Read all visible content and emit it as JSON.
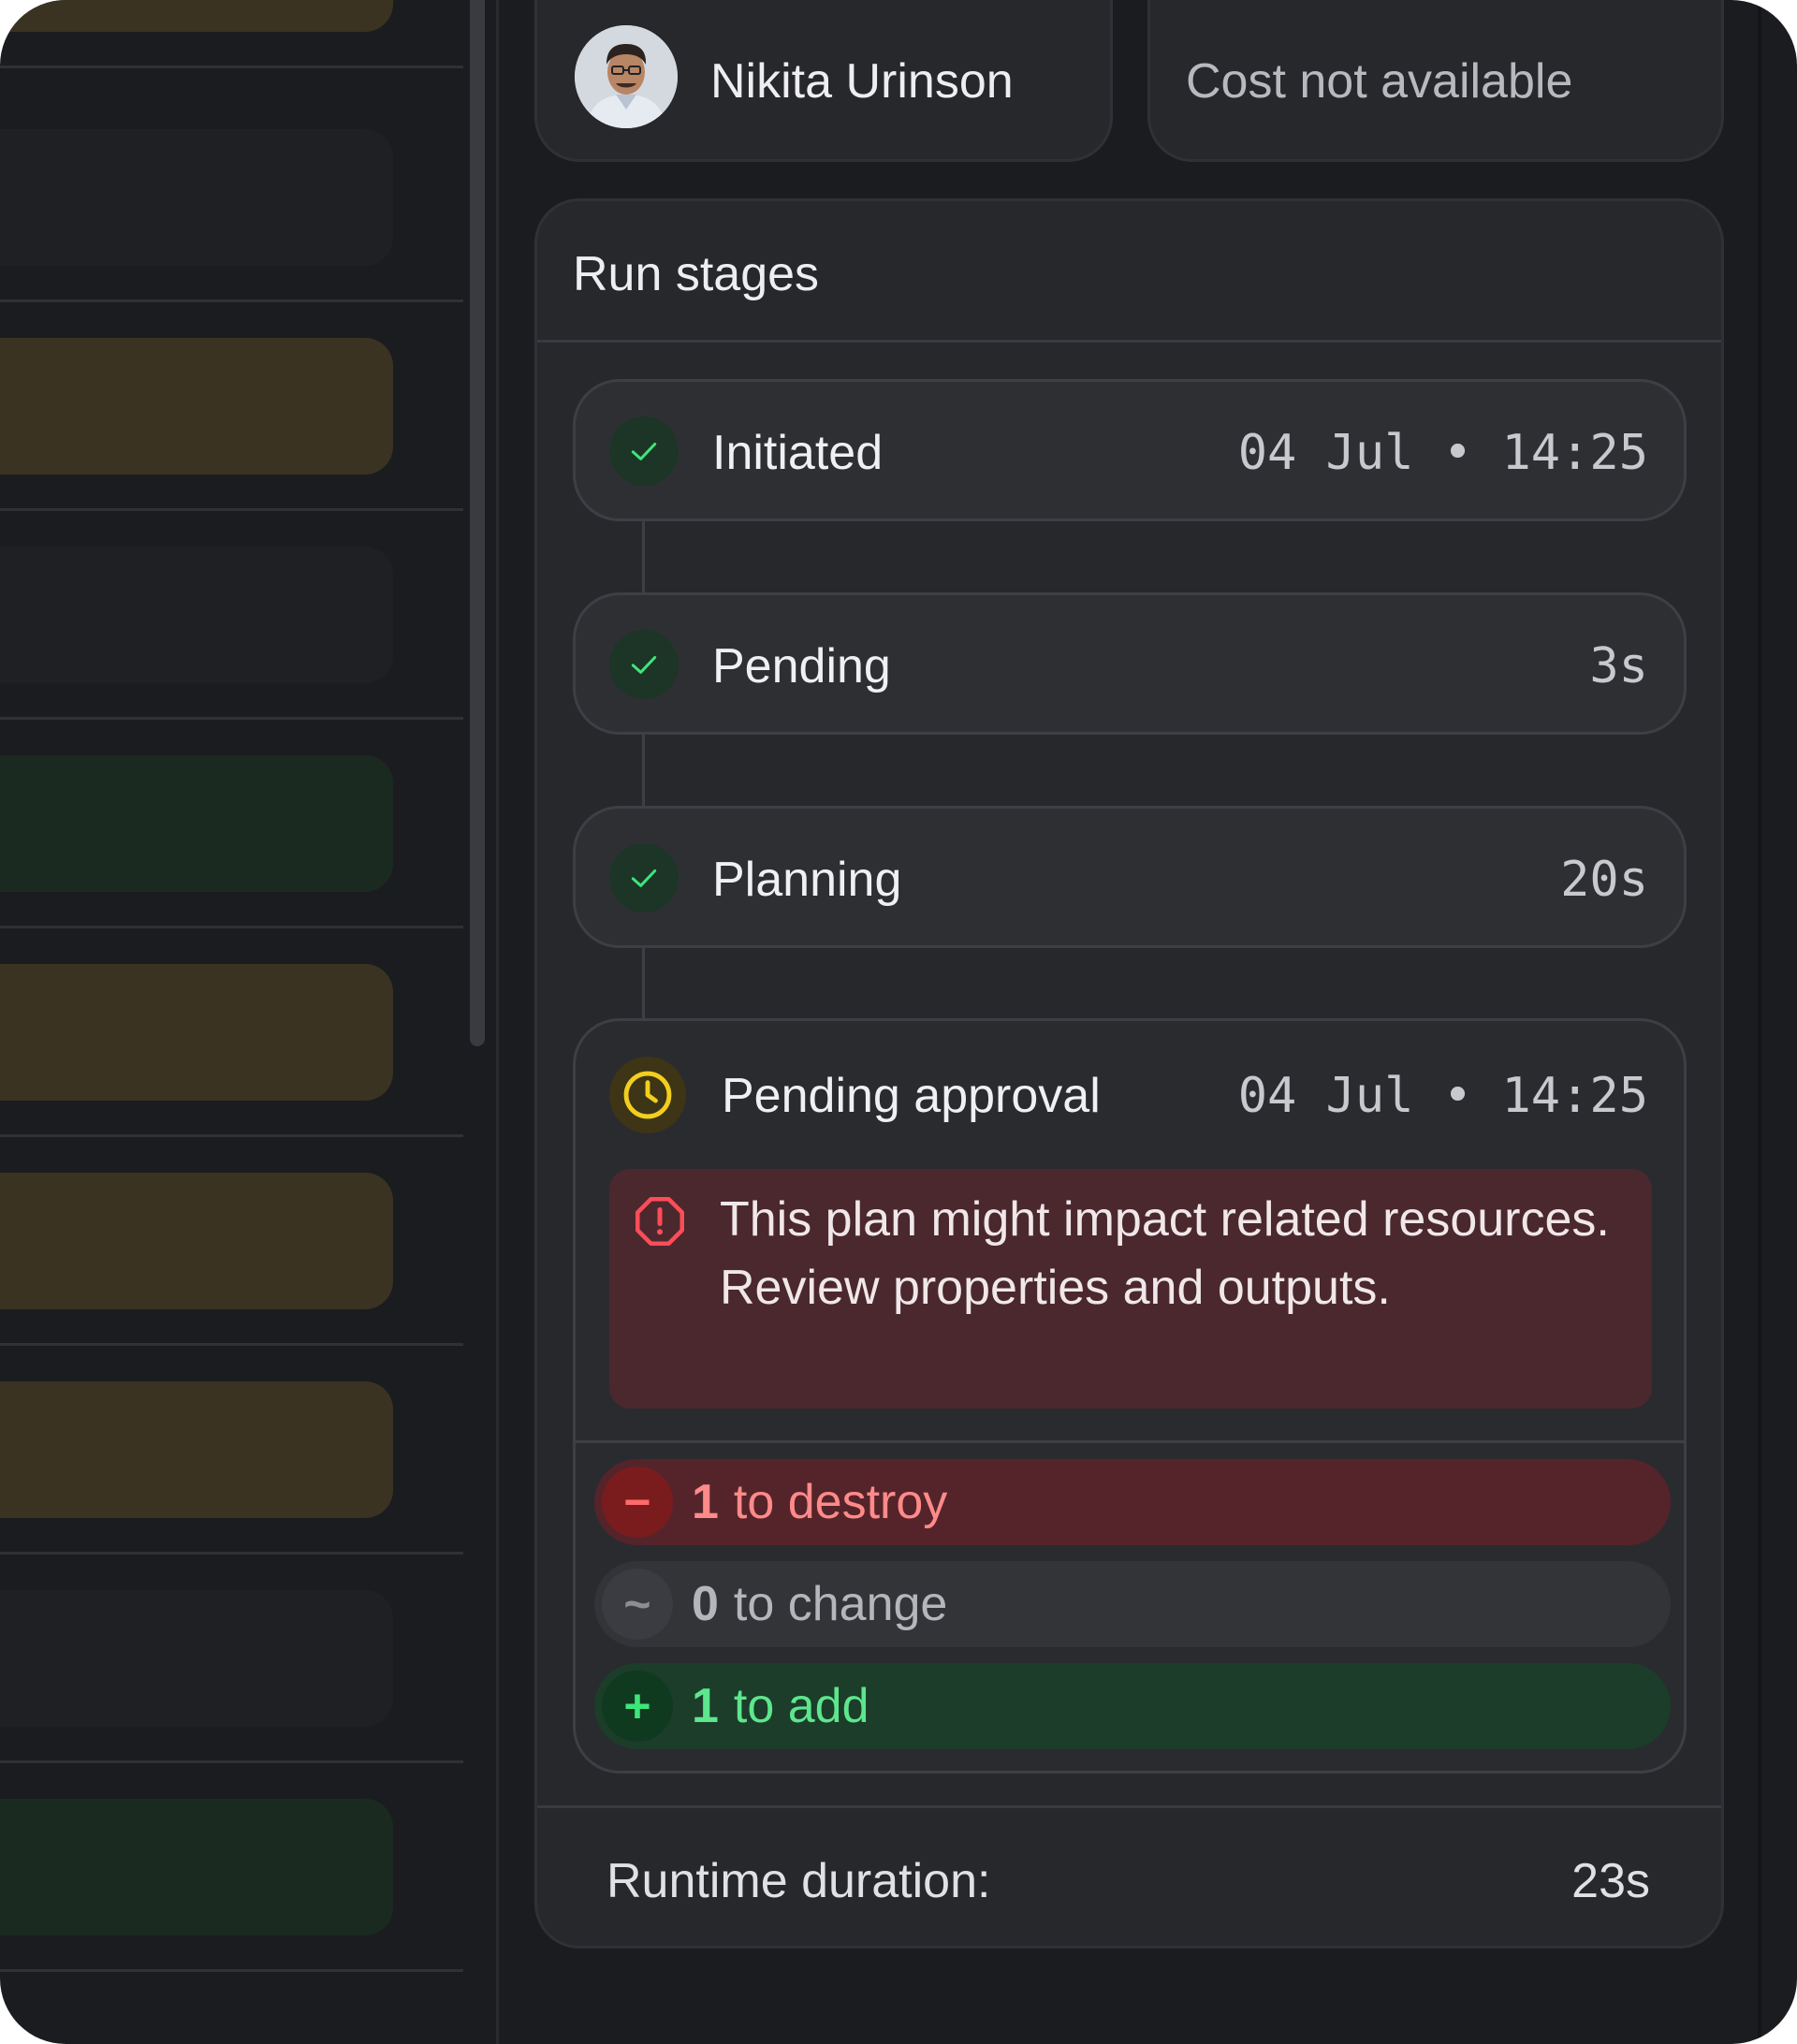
{
  "user": {
    "name": "Nikita Urinson"
  },
  "cost": {
    "text": "Cost not available"
  },
  "run_stages": {
    "title": "Run stages",
    "stages": [
      {
        "label": "Initiated",
        "meta": "04 Jul • 14:25",
        "status": "complete"
      },
      {
        "label": "Pending",
        "meta": "3s",
        "status": "complete"
      },
      {
        "label": "Planning",
        "meta": "20s",
        "status": "complete"
      }
    ],
    "approval": {
      "label": "Pending approval",
      "meta": "04 Jul • 14:25",
      "status": "pending",
      "warning": "This plan might impact related resources. Review properties and outputs.",
      "changes": {
        "destroy": {
          "icon": "−",
          "count": "1",
          "text": "to destroy"
        },
        "change": {
          "icon": "~",
          "count": "0",
          "text": "to change"
        },
        "add": {
          "icon": "+",
          "count": "1",
          "text": "to add"
        }
      }
    },
    "runtime": {
      "label": "Runtime duration:",
      "value": "23s"
    }
  },
  "colors": {
    "background": "#1b1c1f",
    "card": "#27282c",
    "success": "#3ee57a",
    "pending": "#e8c21a",
    "danger": "#ff6b6b"
  }
}
